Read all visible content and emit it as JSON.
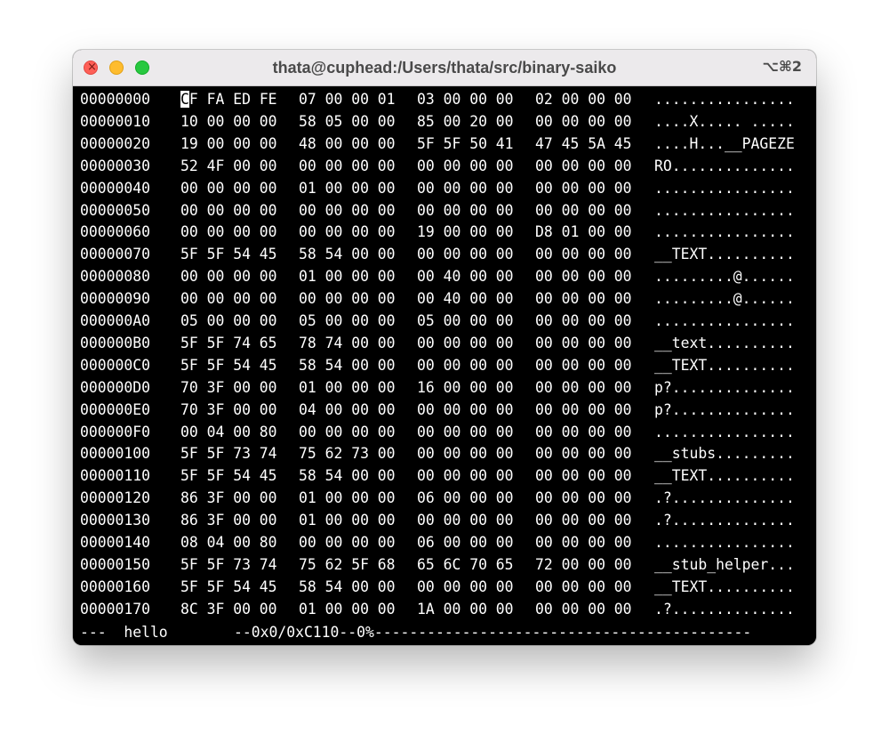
{
  "window": {
    "title": "thata@cuphead:/Users/thata/src/binary-saiko",
    "shortcut": "⌥⌘2",
    "close_glyph": "×"
  },
  "colors": {
    "close": "#fe5f57",
    "minimize": "#febc2e",
    "zoom": "#28c840",
    "terminal_bg": "#000000",
    "terminal_fg": "#ffffff"
  },
  "hexdump": {
    "cursor_char": "C",
    "rows": [
      {
        "addr": "00000000",
        "groups": [
          "CF FA ED FE",
          "07 00 00 01",
          "03 00 00 00",
          "02 00 00 00"
        ],
        "ascii": "................"
      },
      {
        "addr": "00000010",
        "groups": [
          "10 00 00 00",
          "58 05 00 00",
          "85 00 20 00",
          "00 00 00 00"
        ],
        "ascii": "....X..... ....."
      },
      {
        "addr": "00000020",
        "groups": [
          "19 00 00 00",
          "48 00 00 00",
          "5F 5F 50 41",
          "47 45 5A 45"
        ],
        "ascii": "....H...__PAGEZE"
      },
      {
        "addr": "00000030",
        "groups": [
          "52 4F 00 00",
          "00 00 00 00",
          "00 00 00 00",
          "00 00 00 00"
        ],
        "ascii": "RO.............."
      },
      {
        "addr": "00000040",
        "groups": [
          "00 00 00 00",
          "01 00 00 00",
          "00 00 00 00",
          "00 00 00 00"
        ],
        "ascii": "................"
      },
      {
        "addr": "00000050",
        "groups": [
          "00 00 00 00",
          "00 00 00 00",
          "00 00 00 00",
          "00 00 00 00"
        ],
        "ascii": "................"
      },
      {
        "addr": "00000060",
        "groups": [
          "00 00 00 00",
          "00 00 00 00",
          "19 00 00 00",
          "D8 01 00 00"
        ],
        "ascii": "................"
      },
      {
        "addr": "00000070",
        "groups": [
          "5F 5F 54 45",
          "58 54 00 00",
          "00 00 00 00",
          "00 00 00 00"
        ],
        "ascii": "__TEXT.........."
      },
      {
        "addr": "00000080",
        "groups": [
          "00 00 00 00",
          "01 00 00 00",
          "00 40 00 00",
          "00 00 00 00"
        ],
        "ascii": ".........@......"
      },
      {
        "addr": "00000090",
        "groups": [
          "00 00 00 00",
          "00 00 00 00",
          "00 40 00 00",
          "00 00 00 00"
        ],
        "ascii": ".........@......"
      },
      {
        "addr": "000000A0",
        "groups": [
          "05 00 00 00",
          "05 00 00 00",
          "05 00 00 00",
          "00 00 00 00"
        ],
        "ascii": "................"
      },
      {
        "addr": "000000B0",
        "groups": [
          "5F 5F 74 65",
          "78 74 00 00",
          "00 00 00 00",
          "00 00 00 00"
        ],
        "ascii": "__text.........."
      },
      {
        "addr": "000000C0",
        "groups": [
          "5F 5F 54 45",
          "58 54 00 00",
          "00 00 00 00",
          "00 00 00 00"
        ],
        "ascii": "__TEXT.........."
      },
      {
        "addr": "000000D0",
        "groups": [
          "70 3F 00 00",
          "01 00 00 00",
          "16 00 00 00",
          "00 00 00 00"
        ],
        "ascii": "p?.............."
      },
      {
        "addr": "000000E0",
        "groups": [
          "70 3F 00 00",
          "04 00 00 00",
          "00 00 00 00",
          "00 00 00 00"
        ],
        "ascii": "p?.............."
      },
      {
        "addr": "000000F0",
        "groups": [
          "00 04 00 80",
          "00 00 00 00",
          "00 00 00 00",
          "00 00 00 00"
        ],
        "ascii": "................"
      },
      {
        "addr": "00000100",
        "groups": [
          "5F 5F 73 74",
          "75 62 73 00",
          "00 00 00 00",
          "00 00 00 00"
        ],
        "ascii": "__stubs........."
      },
      {
        "addr": "00000110",
        "groups": [
          "5F 5F 54 45",
          "58 54 00 00",
          "00 00 00 00",
          "00 00 00 00"
        ],
        "ascii": "__TEXT.........."
      },
      {
        "addr": "00000120",
        "groups": [
          "86 3F 00 00",
          "01 00 00 00",
          "06 00 00 00",
          "00 00 00 00"
        ],
        "ascii": ".?.............."
      },
      {
        "addr": "00000130",
        "groups": [
          "86 3F 00 00",
          "01 00 00 00",
          "00 00 00 00",
          "00 00 00 00"
        ],
        "ascii": ".?.............."
      },
      {
        "addr": "00000140",
        "groups": [
          "08 04 00 80",
          "00 00 00 00",
          "06 00 00 00",
          "00 00 00 00"
        ],
        "ascii": "................"
      },
      {
        "addr": "00000150",
        "groups": [
          "5F 5F 73 74",
          "75 62 5F 68",
          "65 6C 70 65",
          "72 00 00 00"
        ],
        "ascii": "__stub_helper..."
      },
      {
        "addr": "00000160",
        "groups": [
          "5F 5F 54 45",
          "58 54 00 00",
          "00 00 00 00",
          "00 00 00 00"
        ],
        "ascii": "__TEXT.........."
      },
      {
        "addr": "00000170",
        "groups": [
          "8C 3F 00 00",
          "01 00 00 00",
          "1A 00 00 00",
          "00 00 00 00"
        ],
        "ascii": ".?.............."
      }
    ]
  },
  "status_bar": {
    "left": "---  hello",
    "right": "--0x0/0xC110--0%-------------------------------------------"
  }
}
